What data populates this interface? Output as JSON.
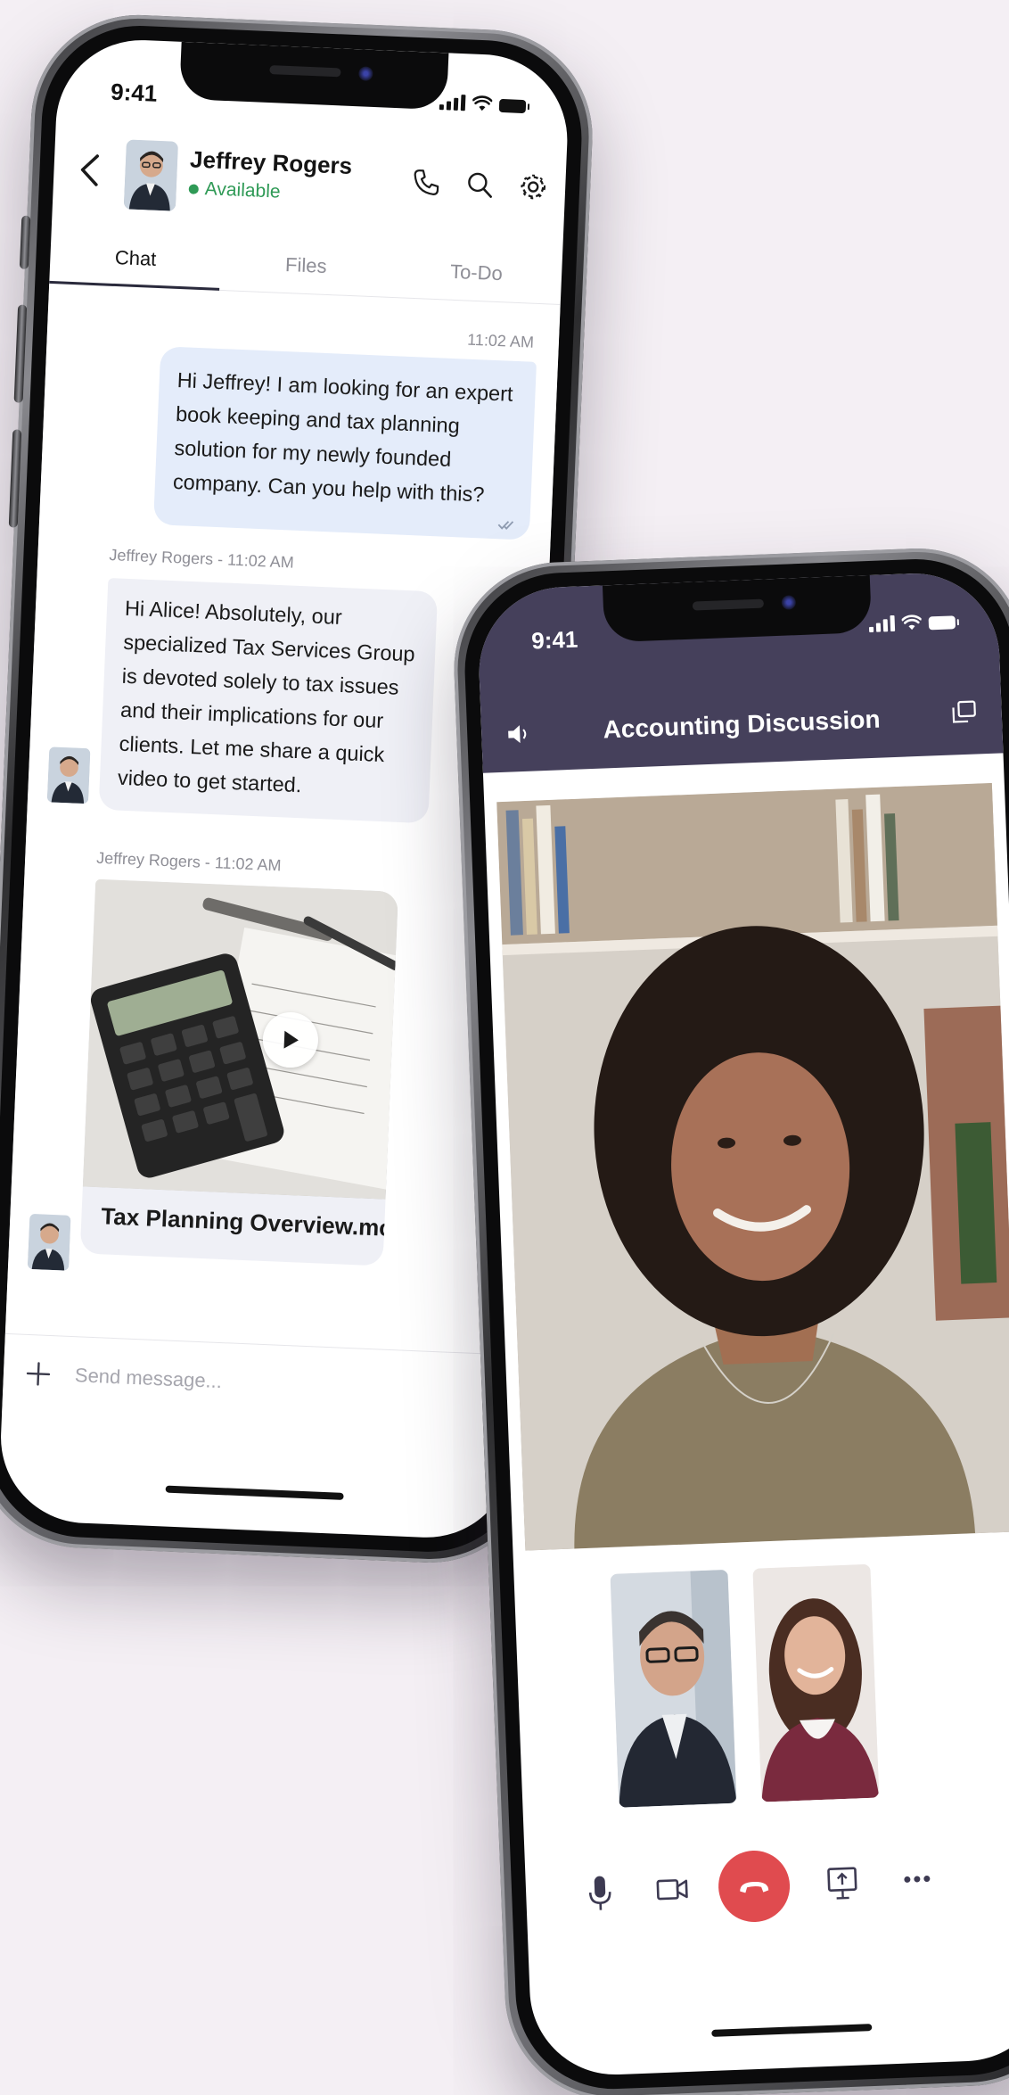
{
  "status_bar": {
    "time": "9:41"
  },
  "chat": {
    "contact_name": "Jeffrey Rogers",
    "contact_status": "Available",
    "tabs": [
      {
        "label": "Chat",
        "active": true
      },
      {
        "label": "Files",
        "active": false
      },
      {
        "label": "To-Do",
        "active": false
      }
    ],
    "messages": [
      {
        "direction": "outgoing",
        "time": "11:02 AM",
        "text": "Hi Jeffrey! I am looking for an expert book keeping and tax planning solution for my newly founded company. Can you help with this?"
      },
      {
        "direction": "incoming",
        "sender_label": "Jeffrey Rogers - 11:02 AM",
        "text": "Hi Alice! Absolutely, our specialized Tax Services Group is devoted solely to tax issues and their implications for our clients. Let me share a quick video to get started."
      },
      {
        "direction": "incoming",
        "sender_label": "Jeffrey Rogers - 11:02 AM",
        "attachment_title": "Tax Planning Overview.mov"
      }
    ],
    "composer_placeholder": "Send message..."
  },
  "call": {
    "title": "Accounting Discussion"
  },
  "colors": {
    "call_header": "#45405b",
    "end_call": "#e04b4f",
    "available": "#2f9a56",
    "outgoing_bubble": "#e4ecfa",
    "incoming_bubble": "#eff0f6"
  }
}
